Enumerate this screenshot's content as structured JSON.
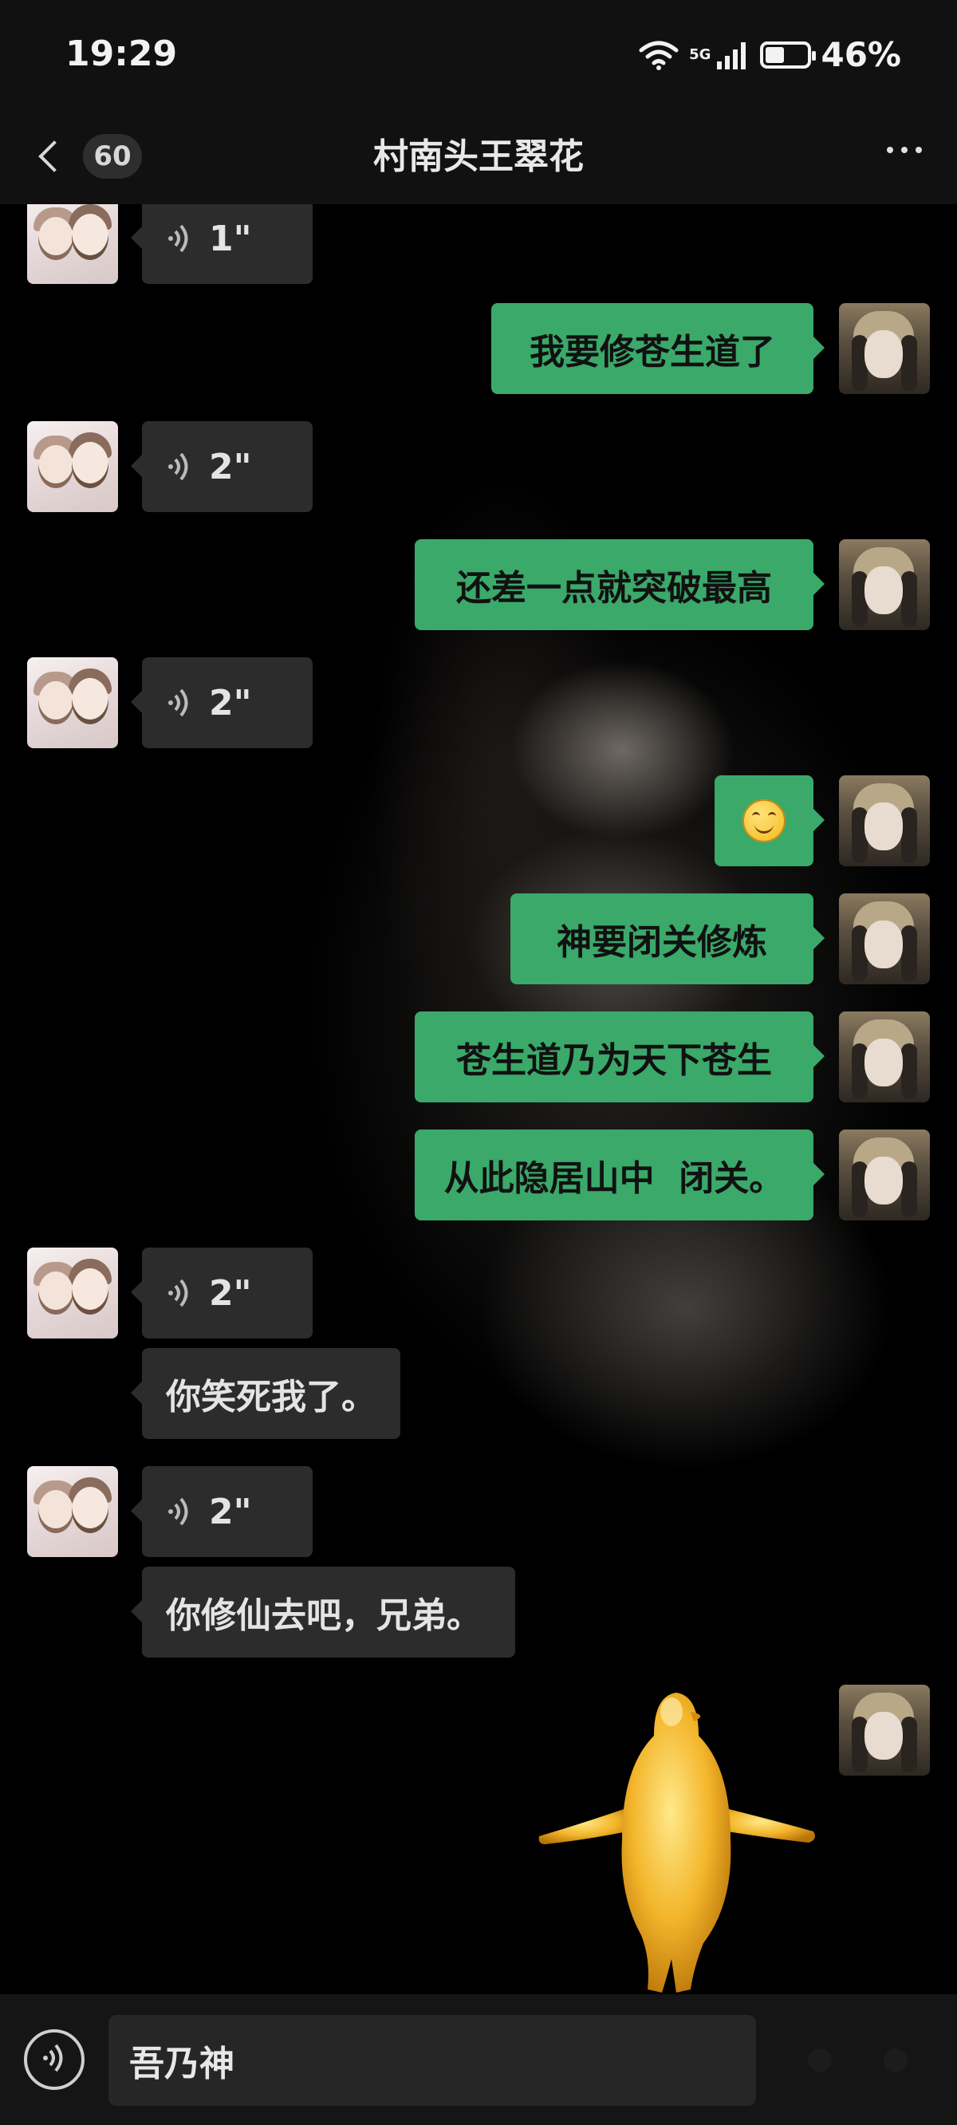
{
  "status_bar": {
    "time": "19:29",
    "network": "5G",
    "battery": "46%",
    "battery_level": 0.46
  },
  "header": {
    "back_icon": "chevron-left-icon",
    "unread_count": "60",
    "title": "村南头王翠花",
    "more_icon": "ellipsis-icon"
  },
  "messages": [
    {
      "from": "other",
      "type": "voice",
      "duration": "1\""
    },
    {
      "from": "me",
      "type": "text",
      "text": "我要修苍生道了"
    },
    {
      "from": "other",
      "type": "voice",
      "duration": "2\""
    },
    {
      "from": "me",
      "type": "text",
      "text": "还差一点就突破最高"
    },
    {
      "from": "other",
      "type": "voice",
      "duration": "2\""
    },
    {
      "from": "me",
      "type": "emoji",
      "emoji": "smile-emoji"
    },
    {
      "from": "me",
      "type": "text",
      "text": "神要闭关修炼"
    },
    {
      "from": "me",
      "type": "text",
      "text": "苍生道乃为天下苍生"
    },
    {
      "from": "me",
      "type": "text",
      "text": "从此隐居山中  闭关。"
    },
    {
      "from": "other",
      "type": "voice",
      "duration": "2\""
    },
    {
      "from": "other",
      "type": "text",
      "text": "你笑死我了。"
    },
    {
      "from": "other",
      "type": "voice",
      "duration": "2\""
    },
    {
      "from": "other",
      "type": "text",
      "text": "你修仙去吧，兄弟。"
    },
    {
      "from": "me",
      "type": "sticker",
      "sticker": "golden-figure-sticker"
    }
  ],
  "input_bar": {
    "voice_icon": "voice-wave-icon",
    "input_value": "吾乃神"
  },
  "colors": {
    "sent_bubble": "#3aa96a",
    "received_bubble": "#2c2c2c",
    "bar_background": "#111111"
  }
}
